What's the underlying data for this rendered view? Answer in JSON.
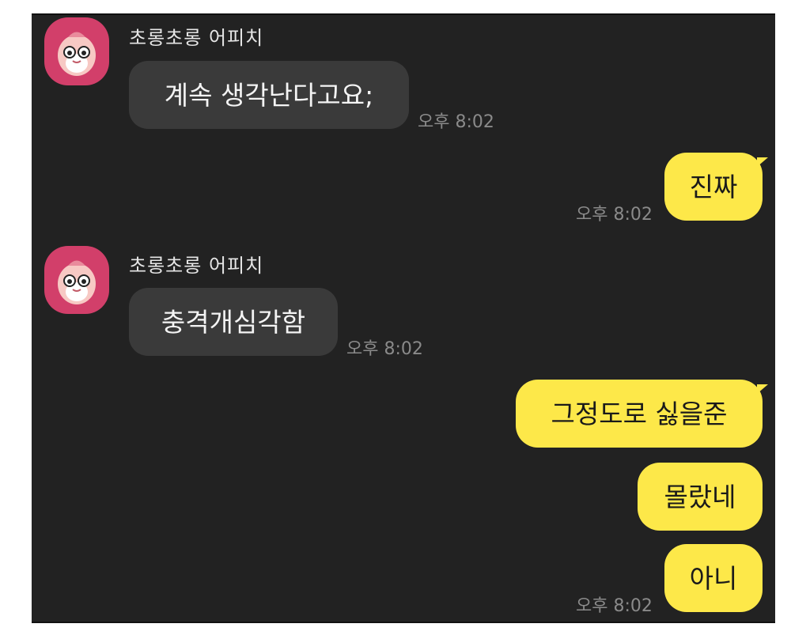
{
  "chat": {
    "messages": [
      {
        "sender": "초롱초롱 어피치",
        "text": "계속 생각난다고요;",
        "time": "오후 8:02"
      },
      {
        "text": "진짜",
        "time": "오후 8:02"
      },
      {
        "sender": "초롱초롱 어피치",
        "text": "충격개심각함",
        "time": "오후 8:02"
      },
      {
        "text": "그정도로 싫을준"
      },
      {
        "text": "몰랐네"
      },
      {
        "text": "아니",
        "time": "오후 8:02"
      }
    ]
  },
  "colors": {
    "chat_background": "#222222",
    "incoming_bubble": "#3a3a3a",
    "outgoing_bubble": "#fde849",
    "avatar_background": "#d23f6a",
    "timestamp": "#8a8a8a"
  },
  "icons": {
    "avatar": "apeach-character-icon"
  }
}
